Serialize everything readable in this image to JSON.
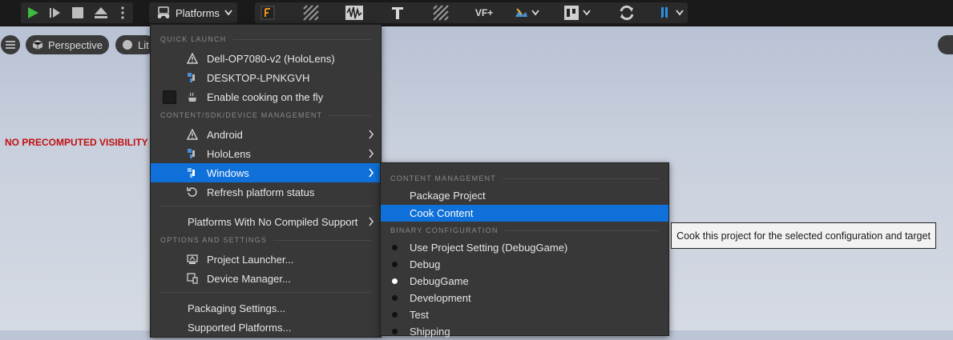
{
  "toolbar": {
    "platforms_label": "Platforms",
    "play_icon": "play-icon",
    "step_icon": "skip-icon",
    "stop_icon": "stop-icon",
    "eject_icon": "eject-icon",
    "more_icon": "kebab-icon",
    "vf_label": "VF+"
  },
  "viewport": {
    "perspective_label": "Perspective",
    "lit_label": "Lit",
    "warning": "NO PRECOMPUTED VISIBILITY"
  },
  "main_menu": {
    "sections": {
      "quick_launch": "QUICK LAUNCH",
      "content": "CONTENT/SDK/DEVICE MANAGEMENT",
      "options": "OPTIONS AND SETTINGS"
    },
    "quick_launch": [
      {
        "label": "Dell-OP7080-v2 (HoloLens)",
        "icon": "warning-icon"
      },
      {
        "label": "DESKTOP-LPNKGVH",
        "icon": "windows-platform-icon"
      },
      {
        "label": "Enable cooking on the fly",
        "icon": "cook-icon"
      }
    ],
    "platforms": [
      {
        "label": "Android",
        "icon": "warning-icon"
      },
      {
        "label": "HoloLens",
        "icon": "windows-platform-icon"
      },
      {
        "label": "Windows",
        "icon": "windows-platform-icon"
      },
      {
        "label": "Refresh platform status",
        "icon": "refresh-icon"
      }
    ],
    "no_compiled": "Platforms With No Compiled Support",
    "options": [
      {
        "label": "Project Launcher...",
        "icon": "launcher-icon"
      },
      {
        "label": "Device Manager...",
        "icon": "device-manager-icon"
      }
    ],
    "packaging": "Packaging Settings...",
    "supported": "Supported Platforms..."
  },
  "sub_menu": {
    "content_section": "CONTENT MANAGEMENT",
    "package_project": "Package Project",
    "cook_content": "Cook Content",
    "binary_section": "BINARY CONFIGURATION",
    "configs": [
      {
        "label": "Use Project Setting (DebugGame)",
        "selected": false
      },
      {
        "label": "Debug",
        "selected": false
      },
      {
        "label": "DebugGame",
        "selected": true
      },
      {
        "label": "Development",
        "selected": false
      },
      {
        "label": "Test",
        "selected": false
      },
      {
        "label": "Shipping",
        "selected": false
      }
    ]
  },
  "tooltip": "Cook this project for the selected configuration and target",
  "colors": {
    "highlight": "#0e70d8",
    "play_green": "#3fb93f",
    "warning_red": "#c01010"
  }
}
